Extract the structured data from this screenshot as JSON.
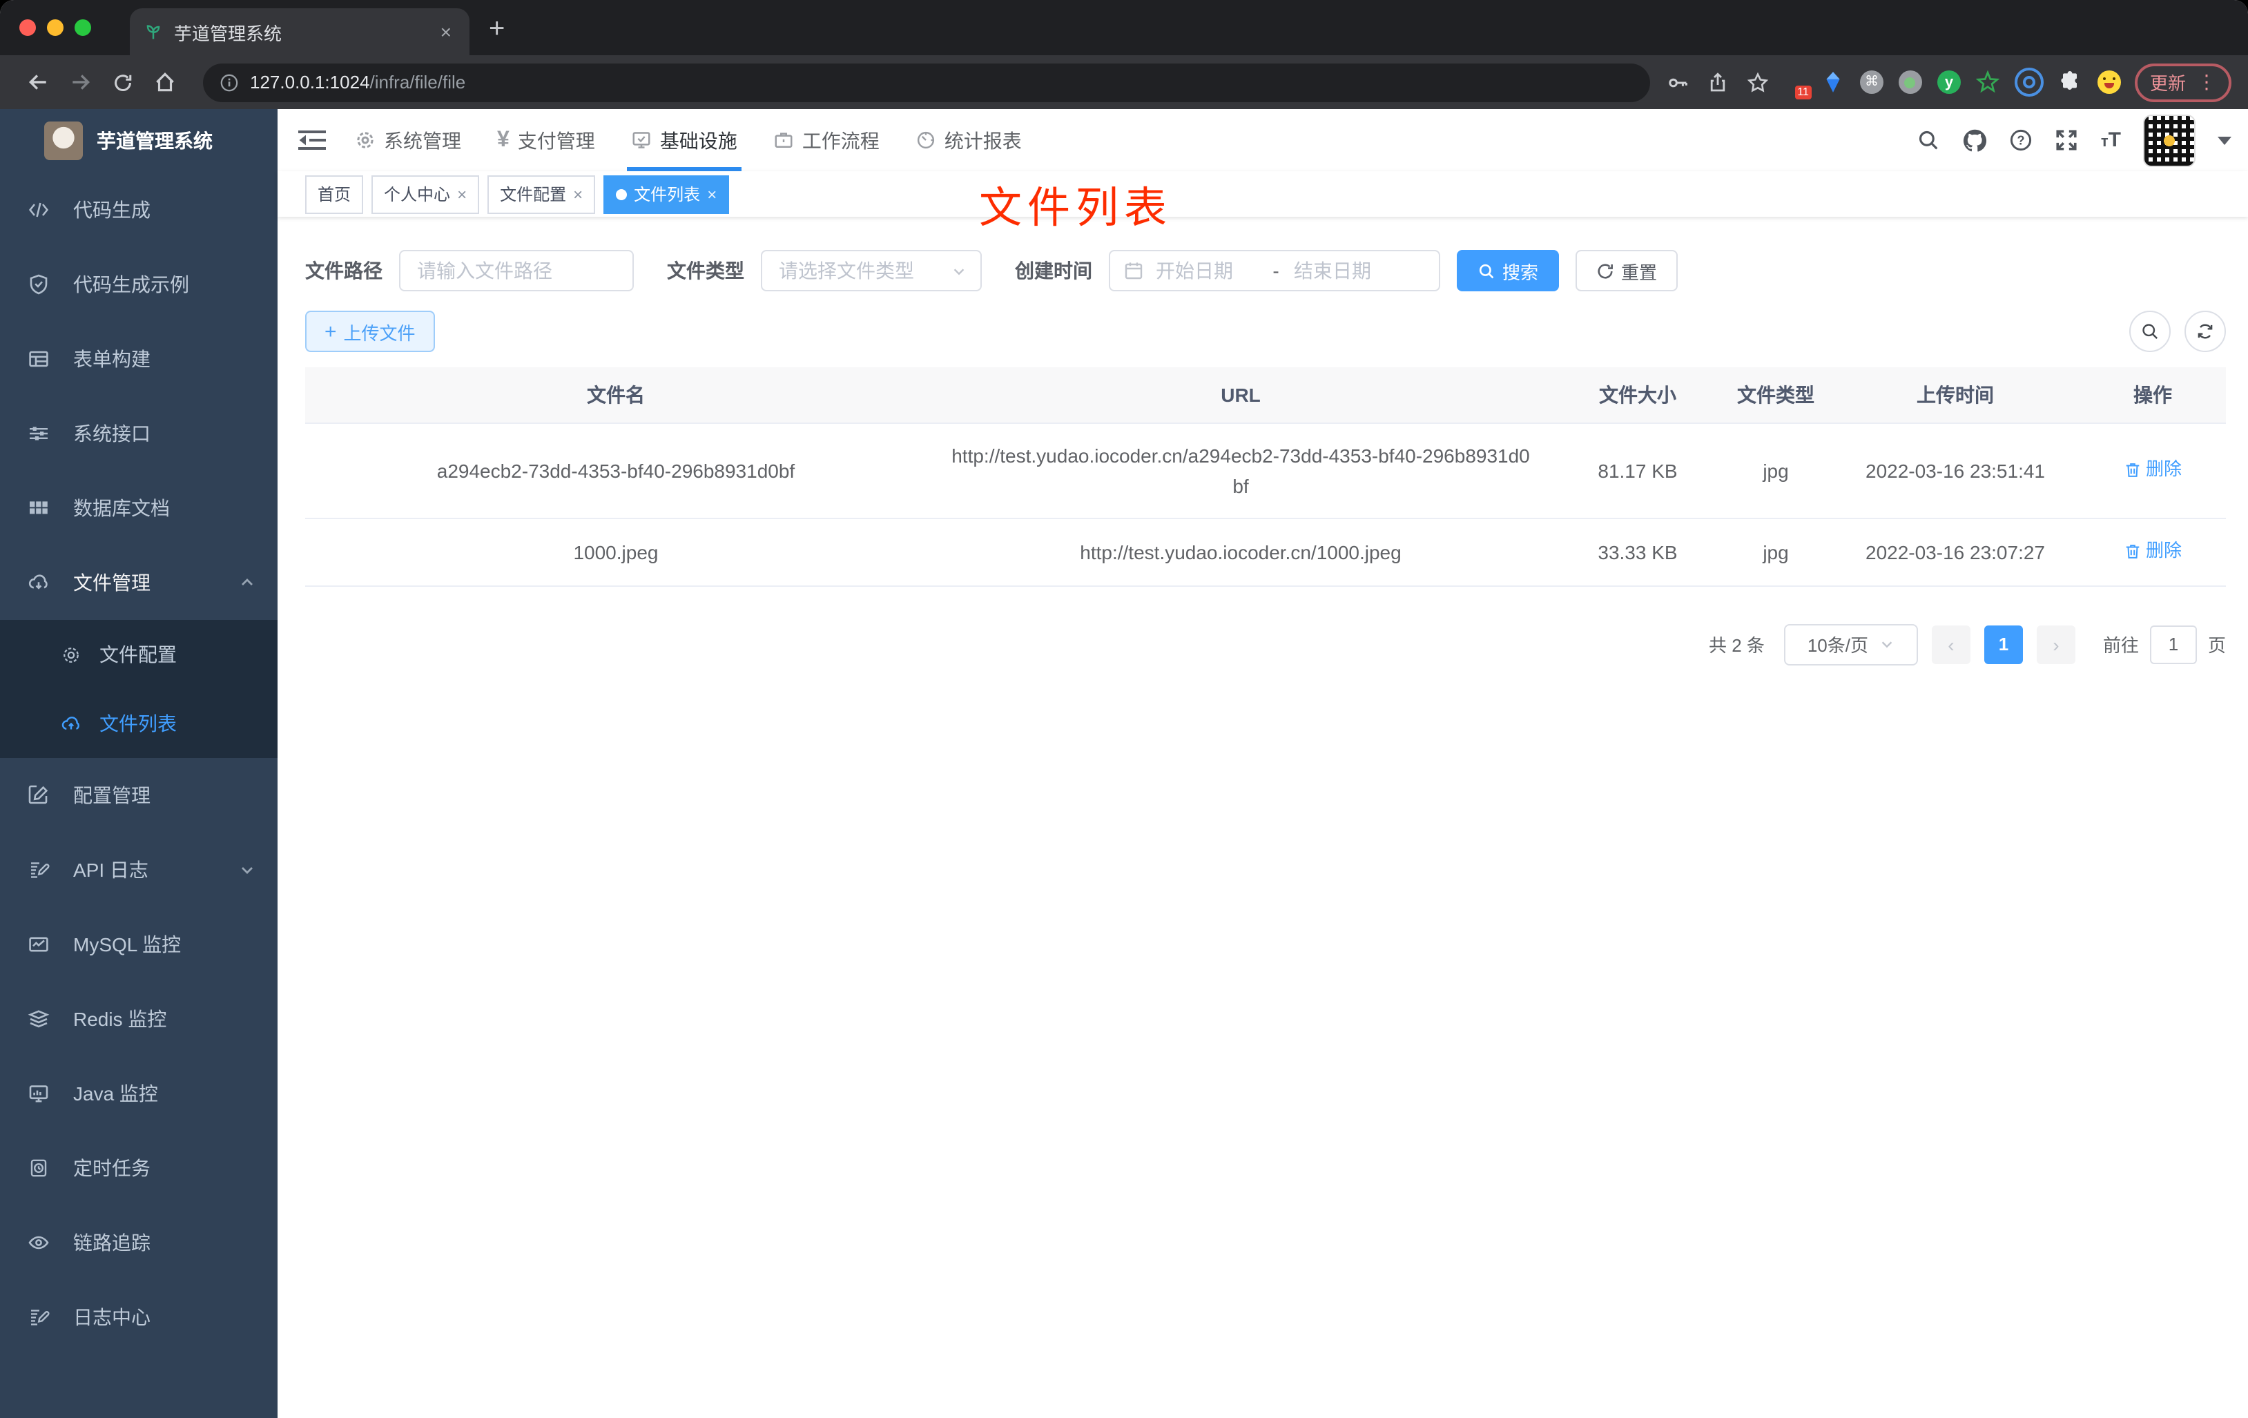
{
  "browser": {
    "tab_title": "芋道管理系统",
    "address_host": "127.0.0.1:1024",
    "address_path": "/infra/file/file",
    "extension_badge": "11",
    "update_label": "更新"
  },
  "glyphs": {
    "close": "×",
    "add": "+",
    "back": "←",
    "forward": "→",
    "prev": "‹",
    "next": "›"
  },
  "sidebar": {
    "title": "芋道管理系统",
    "items": [
      {
        "label": "代码生成"
      },
      {
        "label": "代码生成示例"
      },
      {
        "label": "表单构建"
      },
      {
        "label": "系统接口"
      },
      {
        "label": "数据库文档"
      },
      {
        "label": "文件管理",
        "expanded": true,
        "children": [
          {
            "label": "文件配置"
          },
          {
            "label": "文件列表",
            "active": true
          }
        ]
      },
      {
        "label": "配置管理"
      },
      {
        "label": "API 日志"
      },
      {
        "label": "MySQL 监控"
      },
      {
        "label": "Redis 监控"
      },
      {
        "label": "Java 监控"
      },
      {
        "label": "定时任务"
      },
      {
        "label": "链路追踪"
      },
      {
        "label": "日志中心"
      }
    ]
  },
  "topnav": {
    "items": [
      {
        "label": "系统管理"
      },
      {
        "label": "支付管理",
        "icon_text": "¥"
      },
      {
        "label": "基础设施",
        "active": true
      },
      {
        "label": "工作流程"
      },
      {
        "label": "统计报表"
      }
    ],
    "font_size_icon": "tT"
  },
  "tags": [
    {
      "label": "首页"
    },
    {
      "label": "个人中心",
      "closable": true
    },
    {
      "label": "文件配置",
      "closable": true
    },
    {
      "label": "文件列表",
      "closable": true,
      "active": true
    }
  ],
  "annotation": {
    "text": "文件列表",
    "color": "#fd2c00"
  },
  "filters": {
    "path_label": "文件路径",
    "path_placeholder": "请输入文件路径",
    "type_label": "文件类型",
    "type_placeholder": "请选择文件类型",
    "date_label": "创建时间",
    "date_start_placeholder": "开始日期",
    "date_separator": "-",
    "date_end_placeholder": "结束日期",
    "search_label": "搜索",
    "reset_label": "重置"
  },
  "toolbar": {
    "upload_label": "上传文件"
  },
  "table": {
    "columns": [
      "文件名",
      "URL",
      "文件大小",
      "文件类型",
      "上传时间",
      "操作"
    ],
    "rows": [
      {
        "name": "a294ecb2-73dd-4353-bf40-296b8931d0bf",
        "url": "http://test.yudao.iocoder.cn/a294ecb2-73dd-4353-bf40-296b8931d0bf",
        "size": "81.17 KB",
        "type": "jpg",
        "time": "2022-03-16 23:51:41",
        "action": "删除"
      },
      {
        "name": "1000.jpeg",
        "url": "http://test.yudao.iocoder.cn/1000.jpeg",
        "size": "33.33 KB",
        "type": "jpg",
        "time": "2022-03-16 23:07:27",
        "action": "删除"
      }
    ]
  },
  "pagination": {
    "total": "共 2 条",
    "page_size": "10条/页",
    "current_page": "1",
    "goto_label": "前往",
    "goto_value": "1",
    "page_unit": "页"
  },
  "colors": {
    "primary": "#409eff",
    "sidebar_bg": "#304156",
    "submenu_bg": "#1f2d3d"
  }
}
